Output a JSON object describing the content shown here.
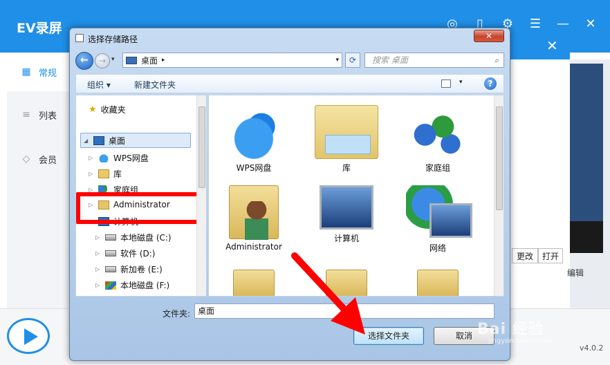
{
  "app": {
    "title": "EV录屏",
    "nav": [
      {
        "label": "常规",
        "icon": "grid-icon"
      },
      {
        "label": "列表",
        "icon": "list-icon"
      },
      {
        "label": "会员",
        "icon": "diamond-icon"
      }
    ],
    "buttons": {
      "change": "更改",
      "open": "打开"
    },
    "edit_label": "编辑",
    "version": "v4.0.2",
    "colors": {
      "brand": "#1f8fe8"
    }
  },
  "dialog": {
    "title": "选择存储路径",
    "close_label": "✕",
    "address": {
      "current": "桌面"
    },
    "search_placeholder": "搜索 桌面",
    "toolbar": {
      "organize": "组织 ▾",
      "new_folder": "新建文件夹"
    },
    "tree": {
      "favorites": "收藏夹",
      "desktop": "桌面",
      "wps": "WPS网盘",
      "library": "库",
      "homegroup": "家庭组",
      "admin": "Administrator",
      "computer": "计算机",
      "drives": [
        "本地磁盘 (C:)",
        "软件 (D:)",
        "新加卷 (E:)",
        "本地磁盘 (F:)"
      ]
    },
    "items": [
      {
        "label": "WPS网盘",
        "icon": "cloud-icon"
      },
      {
        "label": "库",
        "icon": "library-folder-icon"
      },
      {
        "label": "家庭组",
        "icon": "homegroup-icon"
      },
      {
        "label": "Administrator",
        "icon": "user-folder-icon"
      },
      {
        "label": "计算机",
        "icon": "computer-icon"
      },
      {
        "label": "网络",
        "icon": "network-icon"
      }
    ],
    "folder_label": "文件夹:",
    "folder_value": "桌面",
    "select_button": "选择文件夹",
    "cancel_button": "取消"
  },
  "watermark": {
    "text": "Bai 经验",
    "sub": "jingyan.baidu.com"
  }
}
